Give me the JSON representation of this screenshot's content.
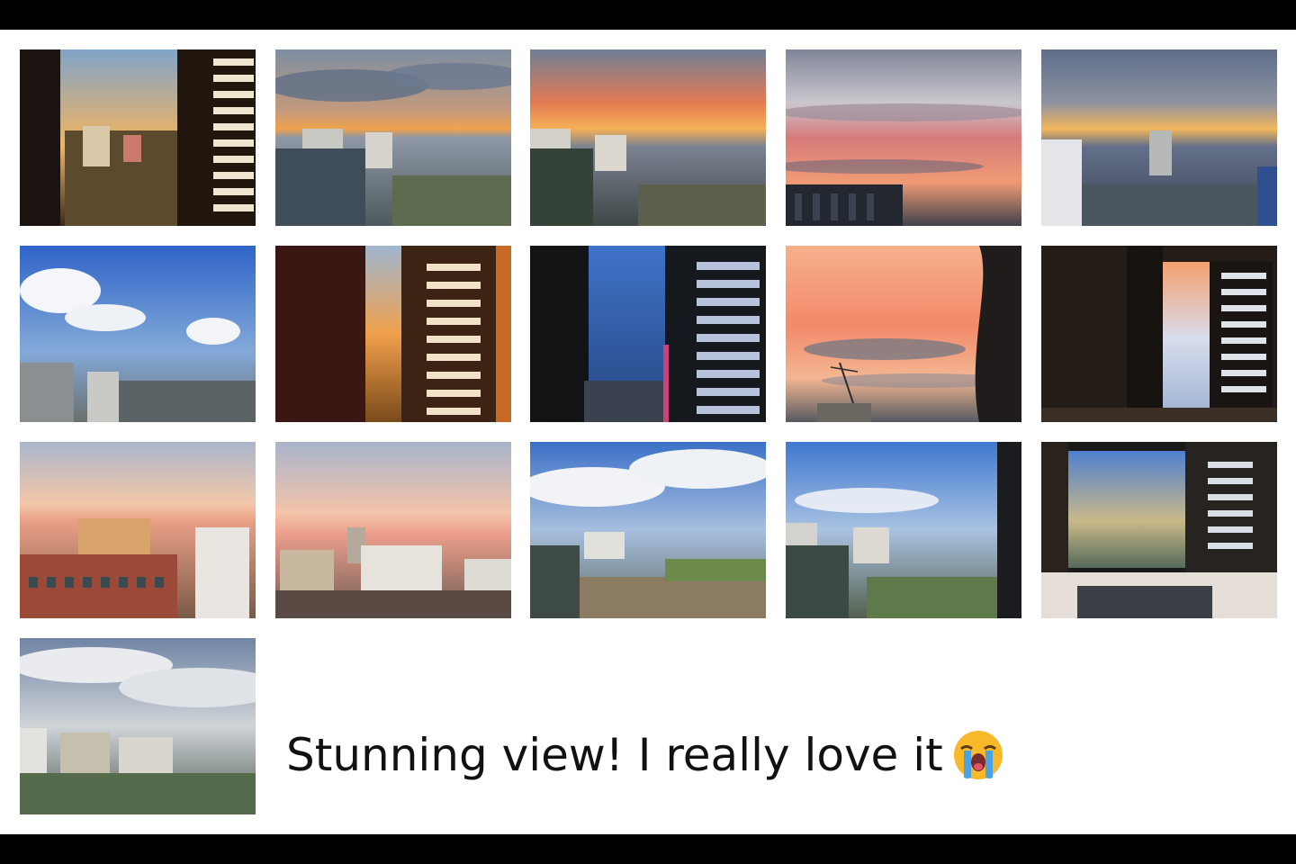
{
  "gallery": {
    "photos": [
      {
        "scene": "window-sunset-city"
      },
      {
        "scene": "cloudy-sunset-skyline"
      },
      {
        "scene": "orange-sunset-skyline"
      },
      {
        "scene": "pink-sunset-clouds"
      },
      {
        "scene": "golden-sunset-skyline"
      },
      {
        "scene": "blue-sky-clouds-city"
      },
      {
        "scene": "curtain-window-sunset"
      },
      {
        "scene": "curtain-window-dusk"
      },
      {
        "scene": "peach-sky-crane"
      },
      {
        "scene": "dark-room-window"
      },
      {
        "scene": "pastel-sunrise-buildings"
      },
      {
        "scene": "pastel-sunrise-city"
      },
      {
        "scene": "daylight-rooftops"
      },
      {
        "scene": "daylight-skyline-window"
      },
      {
        "scene": "desk-window-view"
      },
      {
        "scene": "overcast-skyline"
      }
    ]
  },
  "caption": {
    "text": "Stunning view! I really love it",
    "emoji": "loudly-crying-face-icon"
  }
}
